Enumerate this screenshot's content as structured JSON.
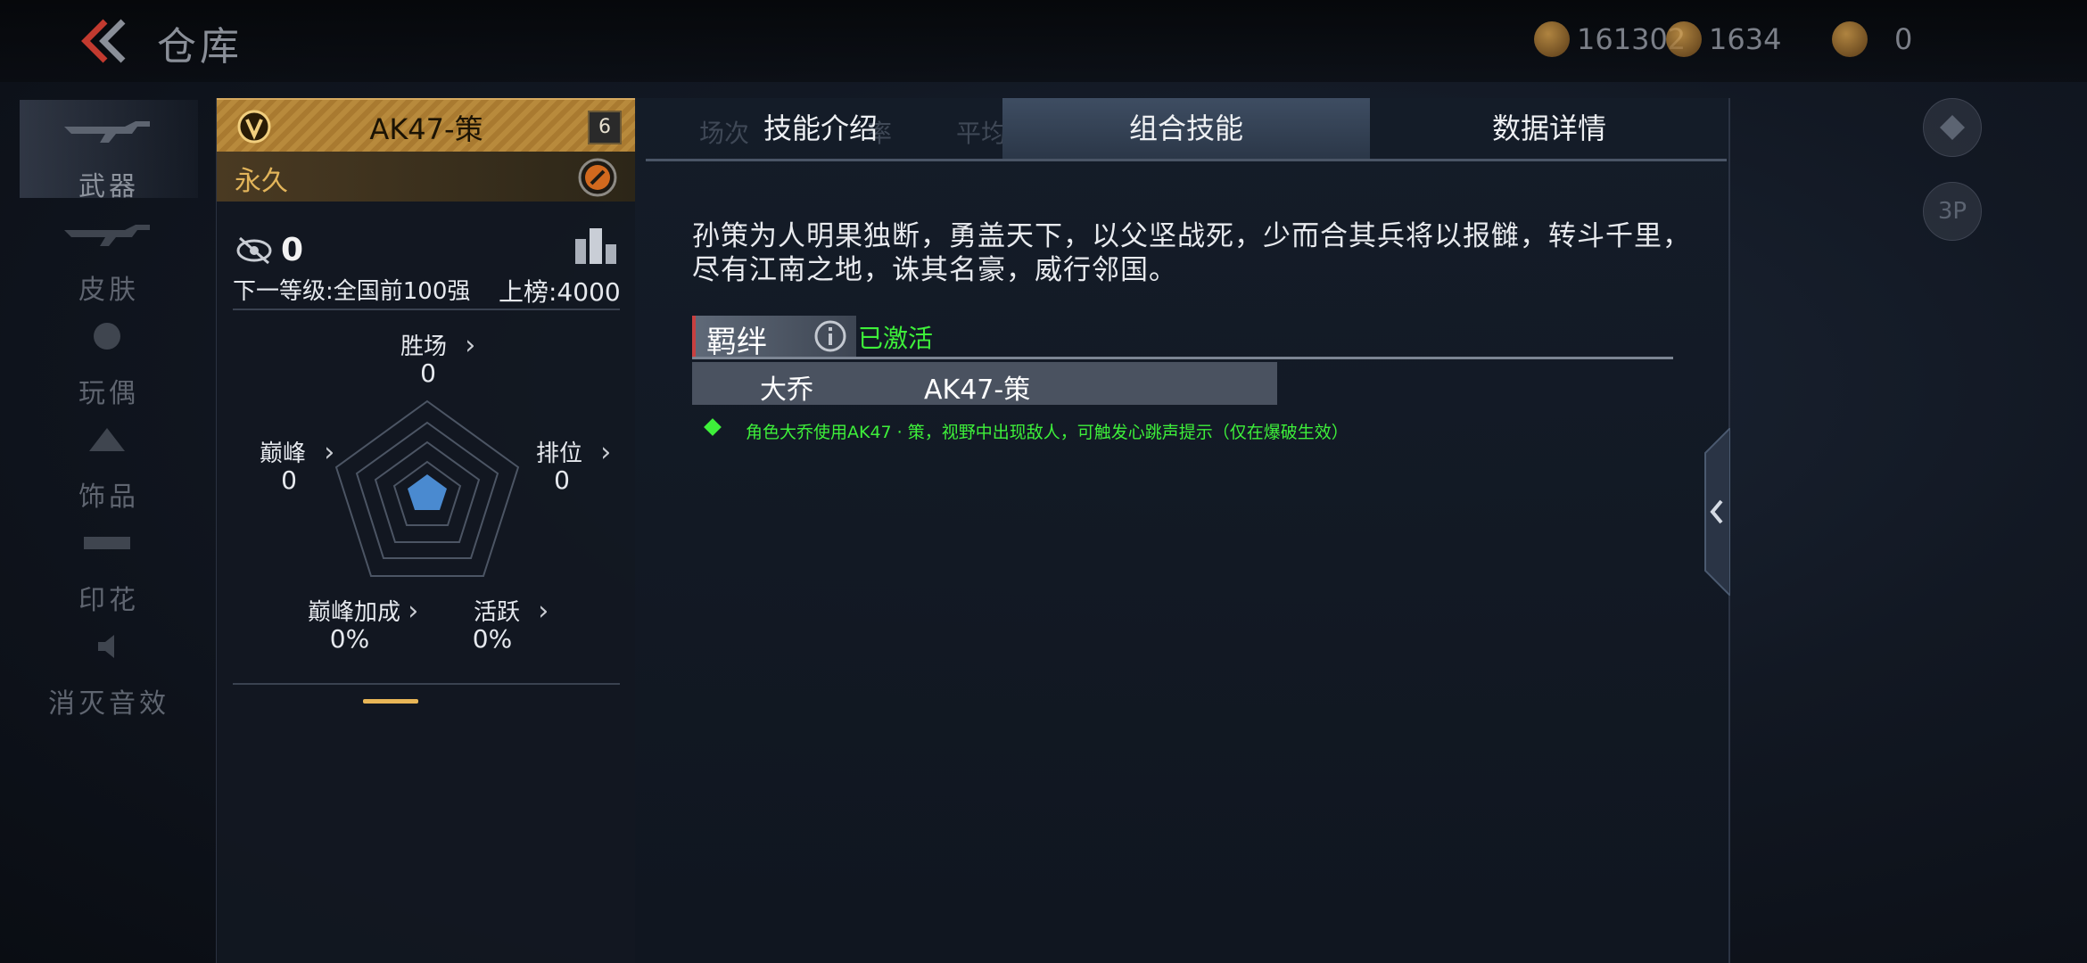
{
  "header": {
    "title": "仓库"
  },
  "currencies": [
    {
      "icon": "gold-coin-icon",
      "value": "161302"
    },
    {
      "icon": "coupon-icon",
      "value": "1634"
    },
    {
      "icon": "token-icon",
      "value": "0"
    }
  ],
  "nav": {
    "items": [
      {
        "label": "武器",
        "icon": "rifle-icon",
        "active": true
      },
      {
        "label": "皮肤",
        "icon": "rifle-skin-icon"
      },
      {
        "label": "玩偶",
        "icon": "doll-icon"
      },
      {
        "label": "饰品",
        "icon": "ornament-icon"
      },
      {
        "label": "印花",
        "icon": "sticker-icon"
      },
      {
        "label": "消灭音效",
        "icon": "speaker-icon"
      }
    ]
  },
  "card": {
    "weapon_name": "AK47-策",
    "level": "6",
    "duration": "永久",
    "kill_count": "0",
    "next_level": "下一等级:全国前100强",
    "on_board": "上榜:4000",
    "radar": {
      "win": {
        "label": "胜场",
        "value": "0"
      },
      "peak": {
        "label": "巅峰",
        "value": "0"
      },
      "rank": {
        "label": "排位",
        "value": "0"
      },
      "peak_bonus": {
        "label": "巅峰加成",
        "value": "0%"
      },
      "active": {
        "label": "活跃",
        "value": "0%"
      }
    }
  },
  "tabs": [
    {
      "label": "技能介绍"
    },
    {
      "label": "组合技能",
      "active": true
    },
    {
      "label": "数据详情"
    }
  ],
  "ghost_tabs": [
    "场次",
    "率",
    "平均KD"
  ],
  "skill": {
    "description": "孙策为人明果独断，勇盖天下，以父坚战死，少而合其兵将以报雠，转斗千里，尽有江南之地，诛其名豪，威行邻国。",
    "bond_label": "羁绊",
    "bond_status": "已激活",
    "bond_character": "大乔",
    "bond_weapon": "AK47-策",
    "effect": "角色大乔使用AK47 · 策，视野中出现敌人，可触发心跳声提示（仅在爆破生效）"
  },
  "side_buttons": {
    "view_label": "3P"
  },
  "colors": {
    "gold": "#b88a3c",
    "activated_green": "#3ef03a",
    "tab_active": "#3e4d62"
  }
}
